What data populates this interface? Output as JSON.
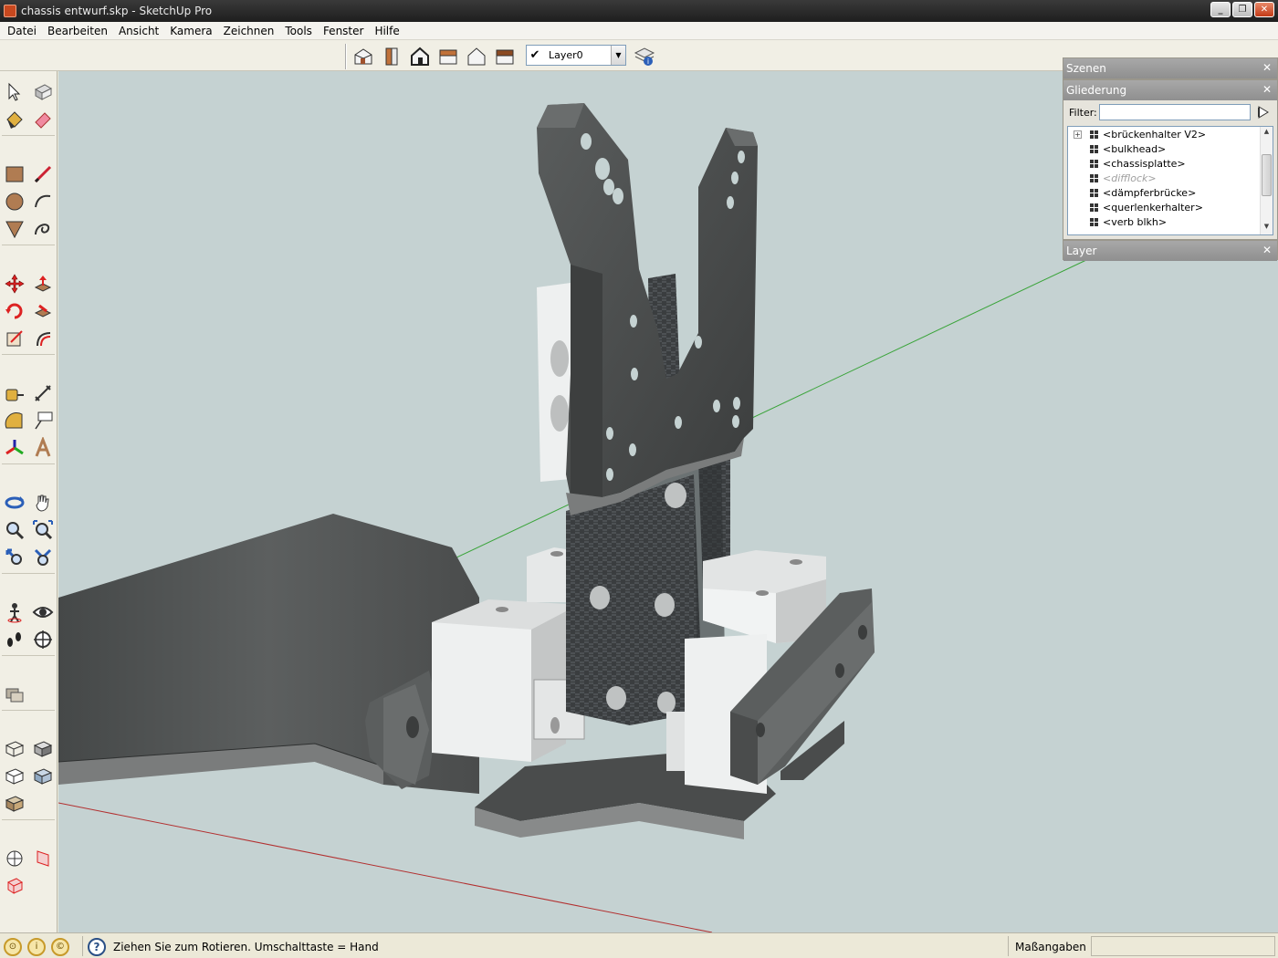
{
  "window": {
    "title": "chassis entwurf.skp - SketchUp Pro"
  },
  "menu": [
    "Datei",
    "Bearbeiten",
    "Ansicht",
    "Kamera",
    "Zeichnen",
    "Tools",
    "Fenster",
    "Hilfe"
  ],
  "toolbar": {
    "views": [
      "iso-view-icon",
      "top-view-icon",
      "front-view-icon",
      "right-view-icon",
      "back-view-icon",
      "left-view-icon"
    ],
    "layer_value": "Layer0"
  },
  "panels": {
    "szenen": {
      "title": "Szenen"
    },
    "gliederung": {
      "title": "Gliederung",
      "filter_label": "Filter:",
      "filter_value": "",
      "items": [
        {
          "label": "<brückenhalter V2>",
          "expandable": true,
          "hidden": false
        },
        {
          "label": "<bulkhead>",
          "expandable": false,
          "hidden": false
        },
        {
          "label": "<chassisplatte>",
          "expandable": false,
          "hidden": false
        },
        {
          "label": "<difflock>",
          "expandable": false,
          "hidden": true
        },
        {
          "label": "<dämpferbrücke>",
          "expandable": false,
          "hidden": false
        },
        {
          "label": "<querlenkerhalter>",
          "expandable": false,
          "hidden": false
        },
        {
          "label": "<verb blkh>",
          "expandable": false,
          "hidden": false
        }
      ]
    },
    "layer": {
      "title": "Layer"
    }
  },
  "status": {
    "hint": "Ziehen Sie zum Rotieren.  Umschalttaste = Hand",
    "measurements_label": "Maßangaben",
    "measurements_value": ""
  },
  "colors": {
    "viewport_bg": "#c5d2d2",
    "green_axis": "#3aa43a",
    "red_axis": "#b23030",
    "dark_part": "#4c4e4e",
    "panel_header": "#9a9a9a"
  }
}
